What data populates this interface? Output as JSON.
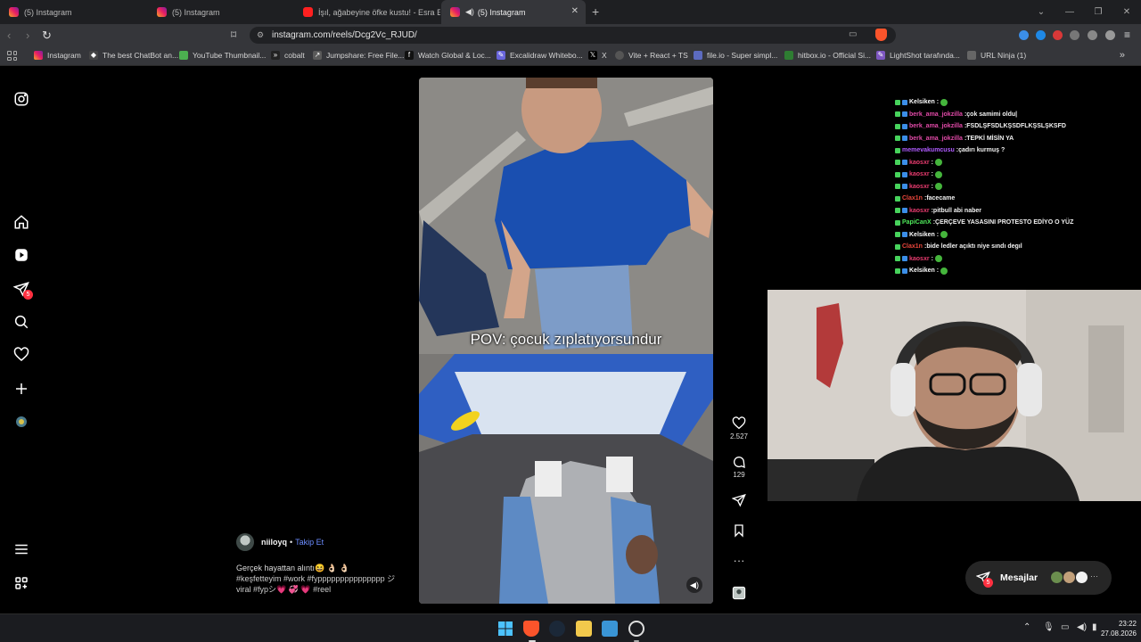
{
  "browser": {
    "tabs": [
      {
        "title": "(5) Instagram",
        "icon": "instagram-icon"
      },
      {
        "title": "(5) Instagram",
        "icon": "instagram-icon"
      },
      {
        "title": "İşıl, ağabeyine öfke kustu! - Esra Erol",
        "icon": "youtube-icon"
      },
      {
        "title": "(5) Instagram",
        "icon": "instagram-icon",
        "active": true
      }
    ],
    "url": "instagram.com/reels/Dcg2Vc_RJUD/",
    "bookmarks": [
      "Instagram",
      "The best ChatBot an...",
      "YouTube Thumbnail...",
      "cobalt",
      "Jumpshare: Free File...",
      "Watch Global & Loc...",
      "Excalidraw Whitebo...",
      "X",
      "Vite + React + TS",
      "file.io - Super simpl...",
      "hitbox.io - Official Si...",
      "LightShot tarafında...",
      "URL Ninja (1)"
    ]
  },
  "sidebar": {
    "notification_count": "5"
  },
  "reel": {
    "overlay_text": "POV: çocuk zıplatıyorsundur",
    "author": "niiloyq",
    "separator": "•",
    "follow_label": "Takip Et",
    "caption": "Gerçek hayattan alıntı😆 👌🏻 👌🏻",
    "hashtags": "#keşfetteyim #work #fyppppppppppppppp ジviral #fypシ💗 💞 💗 #reel",
    "likes": "2.527",
    "comments": "129"
  },
  "chat": [
    {
      "user": "Kelsiken",
      "user_color": "#ffffff",
      "msg": "",
      "emote": true,
      "badges": 2
    },
    {
      "user": "berk_ama_jokzilla",
      "user_color": "#e24aa8",
      "msg": "çok samimi oldu|",
      "emote": false,
      "badges": 2
    },
    {
      "user": "berk_ama_jokzilla",
      "user_color": "#e24aa8",
      "msg": "FSDLŞFSDLKŞSDFLKŞSLŞKSFD",
      "emote": false,
      "badges": 2
    },
    {
      "user": "berk_ama_jokzilla",
      "user_color": "#e24aa8",
      "msg": "TEPKİ MİSİN YA",
      "emote": false,
      "badges": 2
    },
    {
      "user": "memevakumcusu",
      "user_color": "#b05cff",
      "msg": "çadırı kurmuş ?",
      "emote": false,
      "badges": 1
    },
    {
      "user": "kaosxr",
      "user_color": "#e83b6f",
      "msg": "",
      "emote": true,
      "badges": 2
    },
    {
      "user": "kaosxr",
      "user_color": "#e83b6f",
      "msg": "",
      "emote": true,
      "badges": 2
    },
    {
      "user": "kaosxr",
      "user_color": "#e83b6f",
      "msg": "",
      "emote": true,
      "badges": 2
    },
    {
      "user": "Clax1n",
      "user_color": "#e8463b",
      "msg": "facecame",
      "emote": false,
      "badges": 1
    },
    {
      "user": "kaosxr",
      "user_color": "#e83b6f",
      "msg": "pitbull abi naber",
      "emote": false,
      "badges": 2
    },
    {
      "user": "PapiCanX",
      "user_color": "#4ee85a",
      "msg": "ÇERÇEVE YASASINI PROTESTO EDİYO O YÜZ",
      "emote": false,
      "badges": 1
    },
    {
      "user": "Kelsiken",
      "user_color": "#ffffff",
      "msg": "",
      "emote": true,
      "badges": 2
    },
    {
      "user": "Clax1n",
      "user_color": "#e8463b",
      "msg": "bide ledler açıktı niye sındı degıl",
      "emote": false,
      "badges": 1
    },
    {
      "user": "kaosxr",
      "user_color": "#e83b6f",
      "msg": "",
      "emote": true,
      "badges": 2
    },
    {
      "user": "Kelsiken",
      "user_color": "#ffffff",
      "msg": "",
      "emote": true,
      "badges": 2
    }
  ],
  "messages": {
    "label": "Mesajlar",
    "badge": "5"
  },
  "taskbar": {
    "time": "23:22",
    "date": "27.08.2026"
  }
}
